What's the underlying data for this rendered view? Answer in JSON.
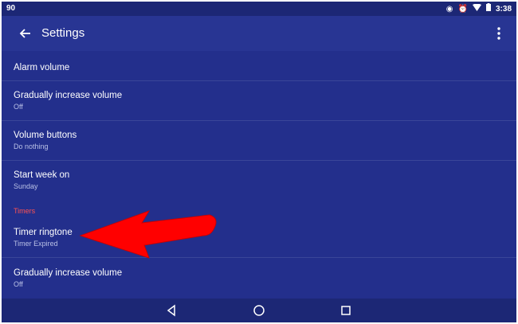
{
  "status": {
    "left": "90",
    "time": "3:38"
  },
  "appbar": {
    "title": "Settings"
  },
  "items": [
    {
      "title": "Alarm volume",
      "subtitle": ""
    },
    {
      "title": "Gradually increase volume",
      "subtitle": "Off"
    },
    {
      "title": "Volume buttons",
      "subtitle": "Do nothing"
    },
    {
      "title": "Start week on",
      "subtitle": "Sunday"
    }
  ],
  "timers": {
    "header": "Timers",
    "items": [
      {
        "title": "Timer ringtone",
        "subtitle": "Timer Expired"
      },
      {
        "title": "Gradually increase volume",
        "subtitle": "Off"
      }
    ]
  },
  "colors": {
    "background": "#232f8c",
    "section_header": "#ff5252",
    "arrow": "#ff0000"
  },
  "icons": {
    "back": "arrow-left-icon",
    "overflow": "more-vert-icon",
    "nav_back": "triangle-back-icon",
    "nav_home": "circle-home-icon",
    "nav_recents": "square-recents-icon"
  }
}
